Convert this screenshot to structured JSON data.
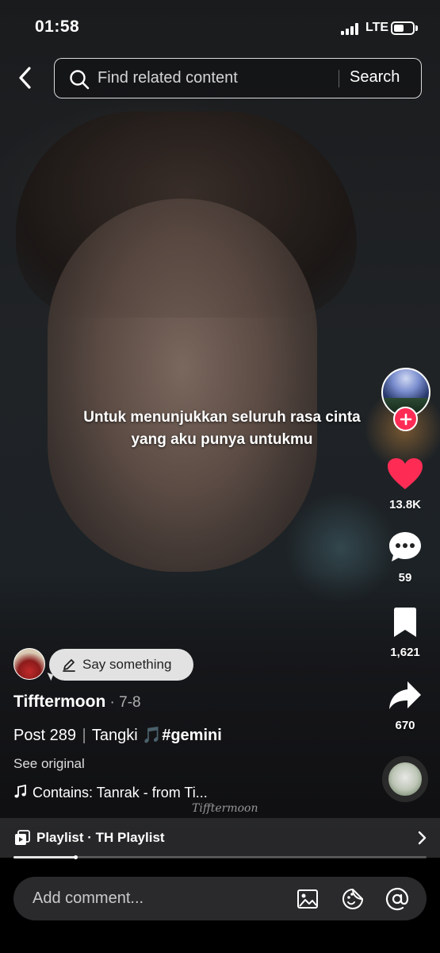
{
  "status_bar": {
    "time": "01:58",
    "network": "LTE",
    "battery_level": 0.55
  },
  "header": {
    "search_placeholder": "Find related content",
    "search_button": "Search"
  },
  "video": {
    "subtitle_line1": "Untuk menunjukkan seluruh rasa cinta",
    "subtitle_line2": "yang aku punya untukmu",
    "watermark": "Tifftermoon"
  },
  "actions": {
    "likes": "13.8K",
    "comments": "59",
    "bookmarks": "1,621",
    "shares": "670"
  },
  "post": {
    "say_something": "Say something",
    "author": "Tifftermoon",
    "date": " · 7-8",
    "caption_part1": "Post 289",
    "caption_sep": "|",
    "caption_part2": "Tangki",
    "caption_note": "🎵",
    "hashtag": "#gemini",
    "see_original": "See original",
    "music": "Contains: Tanrak - from Ti..."
  },
  "playlist": {
    "label": "Playlist · TH Playlist",
    "progress": 0.15
  },
  "comment_bar": {
    "placeholder": "Add comment..."
  },
  "colors": {
    "like": "#fe2c55",
    "follow": "#fe2c55"
  }
}
